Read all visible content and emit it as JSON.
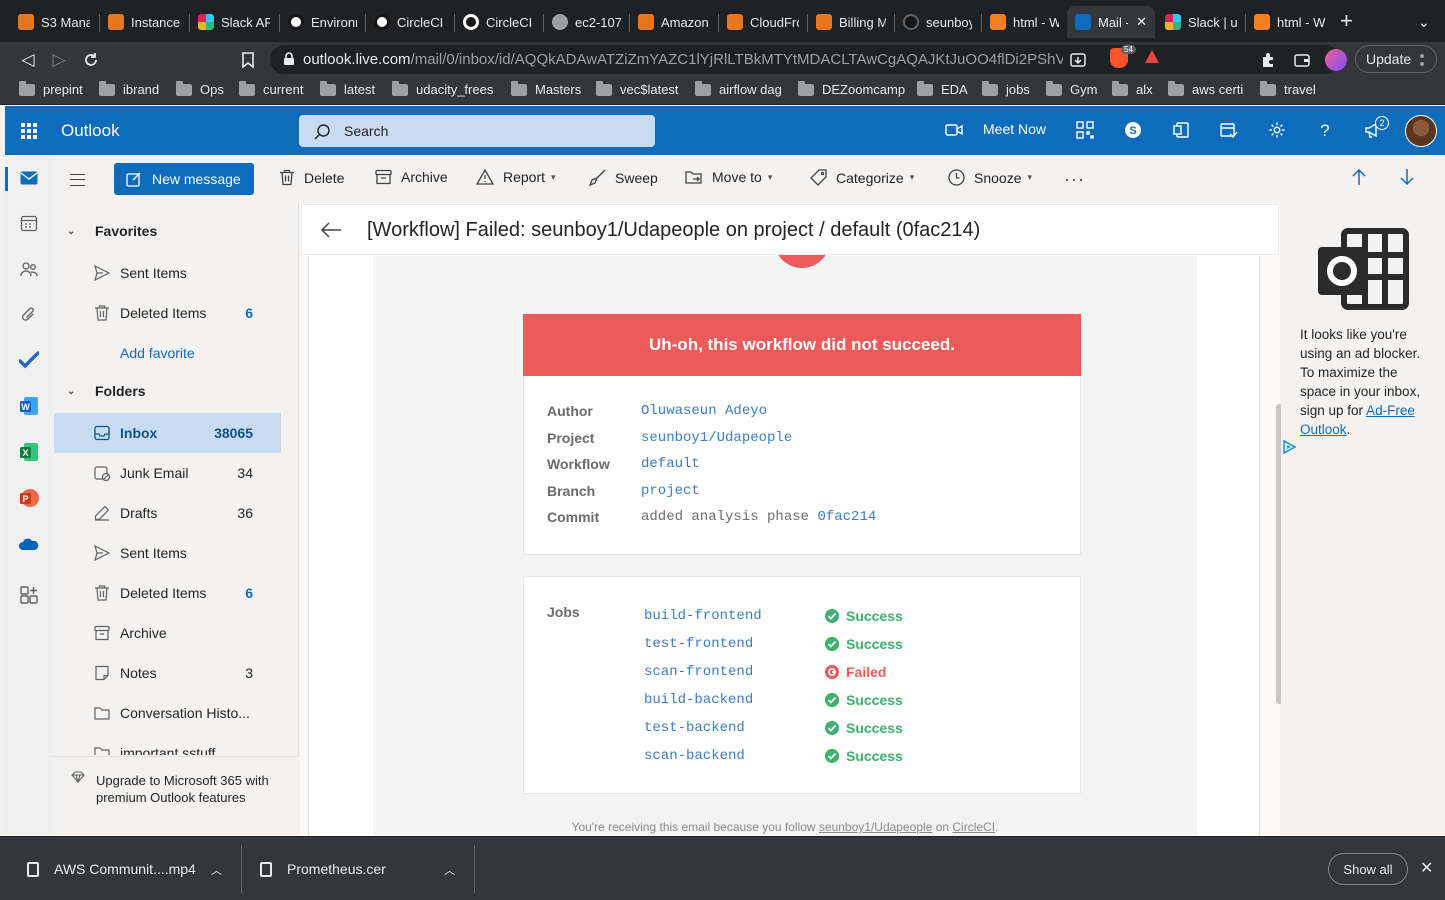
{
  "browser": {
    "tabs": [
      {
        "title": "S3 Mana",
        "color": "#e8761e"
      },
      {
        "title": "Instance",
        "color": "#e8761e"
      },
      {
        "title": "Slack API",
        "color": "#e01e5a"
      },
      {
        "title": "Environm",
        "color": "#161616"
      },
      {
        "title": "CircleCI",
        "color": "#161616"
      },
      {
        "title": "CircleCI",
        "color": "#ffffff"
      },
      {
        "title": "ec2-107-",
        "color": "#9aa0a6"
      },
      {
        "title": "Amazon",
        "color": "#e8761e"
      },
      {
        "title": "CloudFro",
        "color": "#e8761e"
      },
      {
        "title": "Billing M",
        "color": "#e8761e"
      },
      {
        "title": "seunboy",
        "color": "#161616"
      },
      {
        "title": "html - W",
        "color": "#f48024"
      },
      {
        "title": "Mail -",
        "color": "#0f6cbd"
      },
      {
        "title": "Slack | u",
        "color": "#e01e5a"
      },
      {
        "title": "html - W",
        "color": "#f48024"
      }
    ],
    "url_host": "outlook.live.com",
    "url_path": "/mail/0/inbox/id/AQQkADAwATZiZmYAZC1lYjRlLTBkMTYtMDACLTAwCgAQAJKtJuOO4flDi2PShV6...",
    "brave_count": "54",
    "update_label": "Update",
    "bookmarks": [
      "prepint",
      "ibrand",
      "Ops",
      "current",
      "latest",
      "udacity_frees",
      "Masters",
      "vec$latest",
      "airflow dag",
      "DEZoomcamp",
      "EDA",
      "jobs",
      "Gym",
      "alx",
      "aws certi",
      "travel"
    ]
  },
  "header": {
    "app_name": "Outlook",
    "search_placeholder": "Search",
    "meet_now": "Meet Now",
    "notification_count": "2"
  },
  "commands": {
    "new_message": "New message",
    "delete": "Delete",
    "archive": "Archive",
    "report": "Report",
    "sweep": "Sweep",
    "move_to": "Move to",
    "categorize": "Categorize",
    "snooze": "Snooze"
  },
  "folders": {
    "favorites_title": "Favorites",
    "favorites": [
      {
        "label": "Sent Items",
        "count": ""
      },
      {
        "label": "Deleted Items",
        "count": "6"
      }
    ],
    "add_favorite": "Add favorite",
    "folders_title": "Folders",
    "items": [
      {
        "label": "Inbox",
        "count": "38065"
      },
      {
        "label": "Junk Email",
        "count": "34"
      },
      {
        "label": "Drafts",
        "count": "36"
      },
      {
        "label": "Sent Items",
        "count": ""
      },
      {
        "label": "Deleted Items",
        "count": "6"
      },
      {
        "label": "Archive",
        "count": ""
      },
      {
        "label": "Notes",
        "count": "3"
      },
      {
        "label": "Conversation Histo...",
        "count": ""
      },
      {
        "label": "important sstuff",
        "count": ""
      }
    ],
    "upgrade_text": "Upgrade to Microsoft 365 with premium Outlook features"
  },
  "message": {
    "subject": "[Workflow] Failed: seunboy1/Udapeople on project / default (0fac214)",
    "banner": "Uh-oh, this workflow did not succeed.",
    "details": {
      "author_label": "Author",
      "author": "Oluwaseun Adeyo",
      "project_label": "Project",
      "project": "seunboy1/Udapeople",
      "workflow_label": "Workflow",
      "workflow": "default",
      "branch_label": "Branch",
      "branch": "project",
      "commit_label": "Commit",
      "commit_message": "added analysis phase",
      "commit_hash": "0fac214"
    },
    "jobs_label": "Jobs",
    "jobs": [
      {
        "name": "build-frontend",
        "status": "Success",
        "color": "#3fb06f"
      },
      {
        "name": "test-frontend",
        "status": "Success",
        "color": "#3fb06f"
      },
      {
        "name": "scan-frontend",
        "status": "Failed",
        "color": "#ec5b5a"
      },
      {
        "name": "build-backend",
        "status": "Success",
        "color": "#3fb06f"
      },
      {
        "name": "test-backend",
        "status": "Success",
        "color": "#3fb06f"
      },
      {
        "name": "scan-backend",
        "status": "Success",
        "color": "#3fb06f"
      }
    ],
    "footer_prefix": "You're receiving this email because you follow",
    "footer_project": "seunboy1/Udapeople",
    "footer_on": "on",
    "footer_circleci": "CircleCI"
  },
  "ad": {
    "text": "It looks like you're using an ad blocker. To maximize the space in your inbox, sign up for",
    "link": "Ad-Free Outlook"
  },
  "downloads": {
    "items": [
      "AWS Communit....mp4",
      "Prometheus.cer"
    ],
    "show_all": "Show all"
  },
  "colors": {
    "outlook_blue": "#0f6cbd",
    "circleci_red": "#ec5b5a",
    "success_green": "#3fb06f"
  }
}
